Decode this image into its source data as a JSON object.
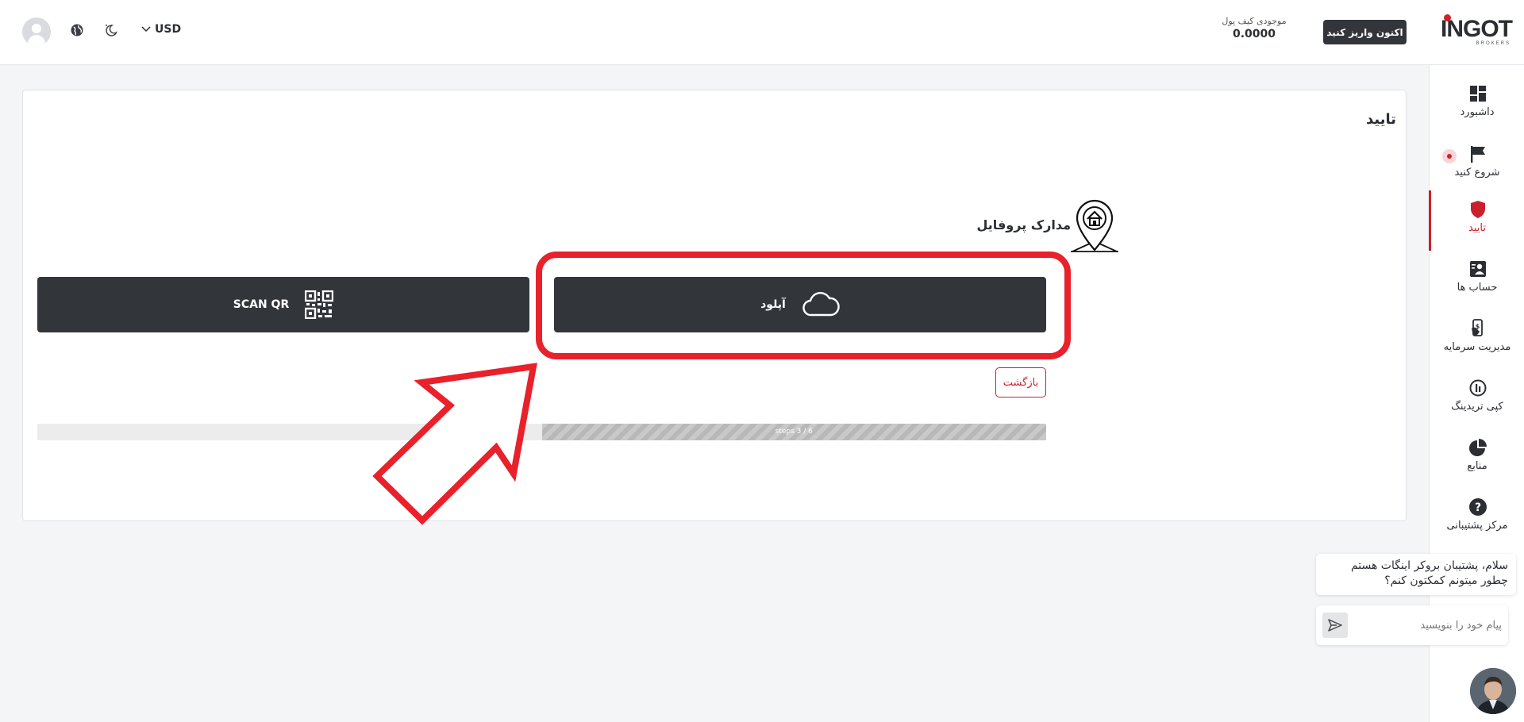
{
  "header": {
    "currency": "USD",
    "wallet_label": "موجودی کیف پول",
    "wallet_value": "0.0000",
    "deposit_label": "اکنون واریز کنید",
    "logo_text": "INGOT",
    "logo_sub": "BROKERS"
  },
  "sidebar": {
    "items": [
      {
        "label": "داشبورد",
        "icon": "dashboard-icon"
      },
      {
        "label": "شروع کنید",
        "icon": "flag-icon"
      },
      {
        "label": "تایید",
        "icon": "shield-icon"
      },
      {
        "label": "حساب ها",
        "icon": "accounts-icon"
      },
      {
        "label": "مدیریت سرمایه",
        "icon": "money-management-icon"
      },
      {
        "label": "کپی تریدینگ",
        "icon": "copy-trading-icon"
      },
      {
        "label": "منابع",
        "icon": "pie-chart-icon"
      },
      {
        "label": "مرکز پشتیبانی",
        "icon": "question-icon"
      }
    ]
  },
  "main": {
    "title": "تایید",
    "section_title": "مدارک پروفایل",
    "upload_label": "آپلود",
    "scan_qr_label": "SCAN QR",
    "back_label": "بازگشت",
    "progress_text": "steps 3 / 6",
    "progress_fraction": 0.5
  },
  "chat": {
    "message": "سلام، پشتیبان بروکر اینگات هستم چطور میتونم کمکتون کنم؟",
    "input_placeholder": "پیام خود را بنویسید"
  },
  "colors": {
    "accent": "#c8202d",
    "dark_button": "#32363b",
    "annotation": "#e8212b"
  }
}
